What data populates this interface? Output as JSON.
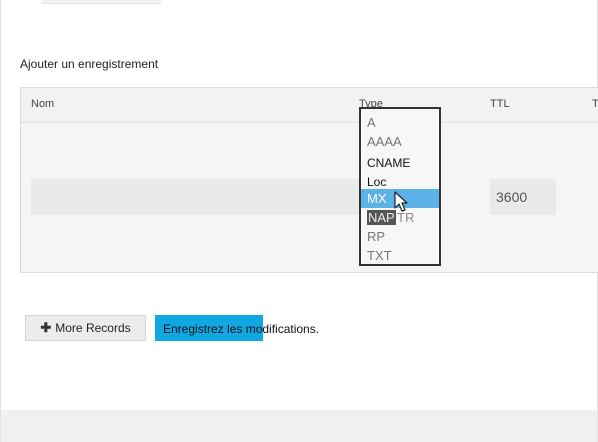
{
  "section": {
    "title": "Ajouter un enregistrement"
  },
  "table": {
    "columns": {
      "name": "Nom",
      "type": "Type",
      "ttl": "TTL",
      "extra": "T"
    },
    "row": {
      "name_value": "",
      "ttl_value": "3600"
    }
  },
  "type_dropdown": {
    "options": [
      "A",
      "AAAA",
      "CNAME",
      "Loc",
      "MX",
      "NAPTR",
      "RP",
      "TXT"
    ],
    "nap_part": "NAP",
    "tr_part": "TR",
    "selected": "MX",
    "highlight_color": "#5cb1e6"
  },
  "actions": {
    "more_records_label": "More Records",
    "save_label": "Enregistrez les modifications."
  },
  "colors": {
    "save_button": "#11a7e3"
  },
  "icons": {
    "plus": "plus-icon",
    "cursor": "mouse-pointer-icon"
  }
}
